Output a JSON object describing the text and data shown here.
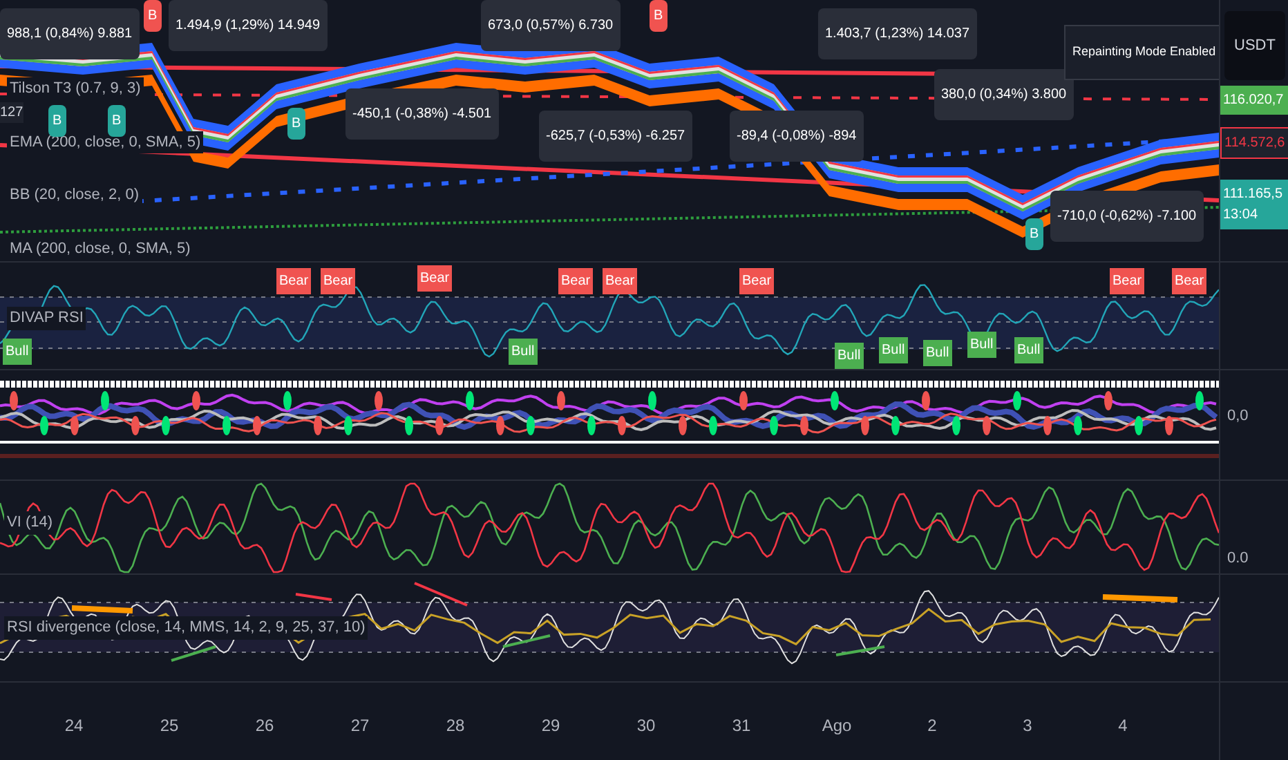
{
  "main": {
    "edge_label": "127",
    "legends": [
      "Tilson T3 (0.7, 9, 3)",
      "EMA (200, close, 0, SMA, 5)",
      "BB (20, close, 2, 0)",
      "MA (200, close, 0, SMA, 5)"
    ],
    "tooltips": [
      {
        "text": "988,1 (0,84%) 9.881"
      },
      {
        "text": "1.494,9 (1,29%) 14.949"
      },
      {
        "text": "673,0 (0,57%) 6.730"
      },
      {
        "text": "-450,1 (-0,38%) -4.501"
      },
      {
        "text": "-625,7 (-0,53%) -6.257"
      },
      {
        "text": "-89,4 (-0,08%) -894"
      },
      {
        "text": "1.403,7 (1,23%) 14.037"
      },
      {
        "text": "380,0 (0,34%) 3.800"
      },
      {
        "text": "-710,0 (-0,62%) -7.100"
      }
    ],
    "signals": [
      {
        "label": "B",
        "kind": "buy"
      },
      {
        "label": "B",
        "kind": "buy"
      },
      {
        "label": "B",
        "kind": "buy"
      },
      {
        "label": "B",
        "kind": "sell"
      },
      {
        "label": "B",
        "kind": "sell"
      },
      {
        "label": "B",
        "kind": "buy"
      }
    ],
    "notice": "Repainting Mode Enabled",
    "axis": {
      "currency": "USDT",
      "labels": [
        {
          "text": "116.020,7",
          "kind": "high"
        },
        {
          "text": "114.572,6",
          "kind": "open"
        },
        {
          "text": "111.165,5",
          "kind": "last"
        }
      ],
      "countdown": "13:04"
    }
  },
  "divap": {
    "title": "DIVAP RSI",
    "labels": [
      {
        "text": "Bull",
        "kind": "bull"
      },
      {
        "text": "Bear",
        "kind": "bear"
      },
      {
        "text": "Bear",
        "kind": "bear"
      },
      {
        "text": "Bear",
        "kind": "bear"
      },
      {
        "text": "Bull",
        "kind": "bull"
      },
      {
        "text": "Bear",
        "kind": "bear"
      },
      {
        "text": "Bear",
        "kind": "bear"
      },
      {
        "text": "Bear",
        "kind": "bear"
      },
      {
        "text": "Bull",
        "kind": "bull"
      },
      {
        "text": "Bull",
        "kind": "bull"
      },
      {
        "text": "Bull",
        "kind": "bull"
      },
      {
        "text": "Bull",
        "kind": "bull"
      },
      {
        "text": "Bull",
        "kind": "bull"
      },
      {
        "text": "Bear",
        "kind": "bear"
      },
      {
        "text": "Bear",
        "kind": "bear"
      }
    ]
  },
  "oscillator": {
    "axis_label": "0,0"
  },
  "vi": {
    "title": "VI (14)",
    "axis_label": "0.0"
  },
  "rsi_div": {
    "title": "RSI divergence (close, 14, MMS, 14, 2, 9, 25, 37, 10)"
  },
  "x_axis": [
    "24",
    "25",
    "26",
    "27",
    "28",
    "29",
    "30",
    "31",
    "Ago",
    "2",
    "3",
    "4"
  ]
}
